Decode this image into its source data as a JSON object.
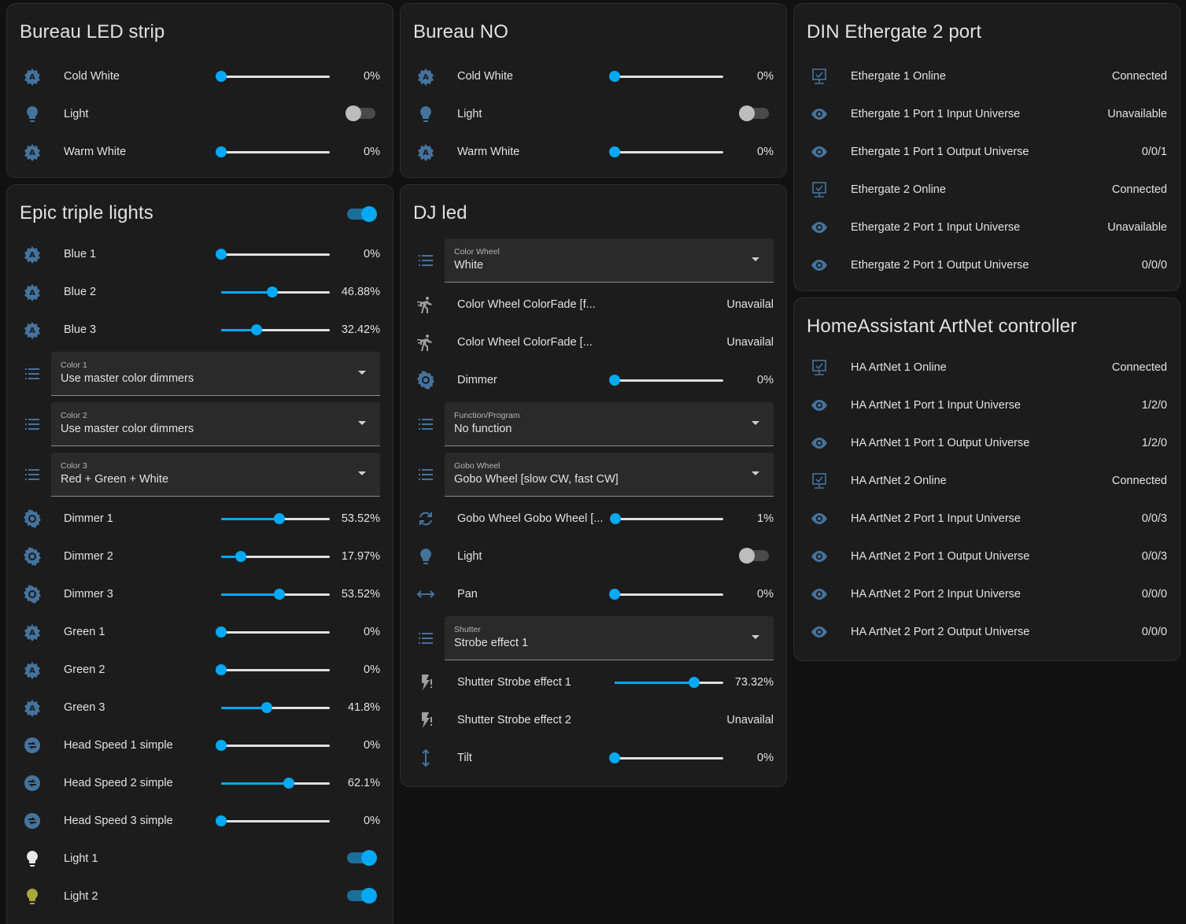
{
  "colors": {
    "accent": "#03a9f4",
    "icon": "#44739e",
    "background": "#111111",
    "card": "#1c1c1c"
  },
  "cards": {
    "bureau_led": {
      "title": "Bureau LED strip",
      "rows": [
        {
          "label": "Cold White",
          "value": "0%",
          "level": 0,
          "icon": "brightness-auto-icon"
        },
        {
          "label": "Light",
          "state": "off",
          "icon": "lightbulb-icon"
        },
        {
          "label": "Warm White",
          "value": "0%",
          "level": 0,
          "icon": "brightness-auto-icon"
        }
      ]
    },
    "bureau_no": {
      "title": "Bureau NO",
      "rows": [
        {
          "label": "Cold White",
          "value": "0%",
          "level": 0,
          "icon": "brightness-auto-icon"
        },
        {
          "label": "Light",
          "state": "off",
          "icon": "lightbulb-icon"
        },
        {
          "label": "Warm White",
          "value": "0%",
          "level": 0,
          "icon": "brightness-auto-icon"
        }
      ]
    },
    "epic": {
      "title": "Epic triple lights",
      "header_toggle": "on",
      "blue1": {
        "label": "Blue 1",
        "value": "0%",
        "level": 0
      },
      "blue2": {
        "label": "Blue 2",
        "value": "46.88%",
        "level": 46.88
      },
      "blue3": {
        "label": "Blue 3",
        "value": "32.42%",
        "level": 32.42
      },
      "color1": {
        "label": "Color 1",
        "selected": "Use master color dimmers"
      },
      "color2": {
        "label": "Color 2",
        "selected": "Use master color dimmers"
      },
      "color3": {
        "label": "Color 3",
        "selected": "Red + Green + White"
      },
      "dimmer1": {
        "label": "Dimmer 1",
        "value": "53.52%",
        "level": 53.52
      },
      "dimmer2": {
        "label": "Dimmer 2",
        "value": "17.97%",
        "level": 17.97
      },
      "dimmer3": {
        "label": "Dimmer 3",
        "value": "53.52%",
        "level": 53.52
      },
      "green1": {
        "label": "Green 1",
        "value": "0%",
        "level": 0
      },
      "green2": {
        "label": "Green 2",
        "value": "0%",
        "level": 0
      },
      "green3": {
        "label": "Green 3",
        "value": "41.8%",
        "level": 41.8
      },
      "speed1": {
        "label": "Head Speed 1 simple",
        "value": "0%",
        "level": 0
      },
      "speed2": {
        "label": "Head Speed 2 simple",
        "value": "62.1%",
        "level": 62.1
      },
      "speed3": {
        "label": "Head Speed 3 simple",
        "value": "0%",
        "level": 0
      },
      "light1": {
        "label": "Light 1",
        "state": "on"
      },
      "light2": {
        "label": "Light 2",
        "state": "on"
      }
    },
    "dj": {
      "title": "DJ led",
      "color_wheel": {
        "label": "Color Wheel",
        "selected": "White"
      },
      "colorfade1": {
        "label": "Color Wheel ColorFade [f...",
        "value": "Unavailal"
      },
      "colorfade2": {
        "label": "Color Wheel ColorFade [...",
        "value": "Unavailal"
      },
      "dimmer": {
        "label": "Dimmer",
        "value": "0%",
        "level": 0
      },
      "function": {
        "label": "Function/Program",
        "selected": "No function"
      },
      "gobo": {
        "label": "Gobo Wheel",
        "selected": "Gobo Wheel [slow CW, fast CW]"
      },
      "gobo_rot": {
        "label": "Gobo Wheel Gobo Wheel [...",
        "value": "1%",
        "level": 1
      },
      "light": {
        "label": "Light",
        "state": "off"
      },
      "pan": {
        "label": "Pan",
        "value": "0%",
        "level": 0
      },
      "shutter": {
        "label": "Shutter",
        "selected": "Strobe effect 1"
      },
      "strobe1": {
        "label": "Shutter Strobe effect 1",
        "value": "73.32%",
        "level": 73.32
      },
      "strobe2": {
        "label": "Shutter Strobe effect 2",
        "value": "Unavailal"
      },
      "tilt": {
        "label": "Tilt",
        "value": "0%",
        "level": 0
      }
    },
    "din": {
      "title": "DIN Ethergate 2 port",
      "rows": [
        {
          "label": "Ethergate 1 Online",
          "value": "Connected",
          "icon": "monitor-check-icon"
        },
        {
          "label": "Ethergate 1 Port 1 Input Universe",
          "value": "Unavailable",
          "icon": "eye-icon"
        },
        {
          "label": "Ethergate 1 Port 1 Output Universe",
          "value": "0/0/1",
          "icon": "eye-icon"
        },
        {
          "label": "Ethergate 2 Online",
          "value": "Connected",
          "icon": "monitor-check-icon"
        },
        {
          "label": "Ethergate 2 Port 1 Input Universe",
          "value": "Unavailable",
          "icon": "eye-icon"
        },
        {
          "label": "Ethergate 2 Port 1 Output Universe",
          "value": "0/0/0",
          "icon": "eye-icon"
        }
      ]
    },
    "ha": {
      "title": "HomeAssistant ArtNet controller",
      "rows": [
        {
          "label": "HA ArtNet 1 Online",
          "value": "Connected",
          "icon": "monitor-check-icon"
        },
        {
          "label": "HA ArtNet 1 Port 1 Input Universe",
          "value": "1/2/0",
          "icon": "eye-icon"
        },
        {
          "label": "HA ArtNet 1 Port 1 Output Universe",
          "value": "1/2/0",
          "icon": "eye-icon"
        },
        {
          "label": "HA ArtNet 2 Online",
          "value": "Connected",
          "icon": "monitor-check-icon"
        },
        {
          "label": "HA ArtNet 2 Port 1 Input Universe",
          "value": "0/0/3",
          "icon": "eye-icon"
        },
        {
          "label": "HA ArtNet 2 Port 1 Output Universe",
          "value": "0/0/3",
          "icon": "eye-icon"
        },
        {
          "label": "HA ArtNet 2 Port 2 Input Universe",
          "value": "0/0/0",
          "icon": "eye-icon"
        },
        {
          "label": "HA ArtNet 2 Port 2 Output Universe",
          "value": "0/0/0",
          "icon": "eye-icon"
        }
      ]
    }
  }
}
